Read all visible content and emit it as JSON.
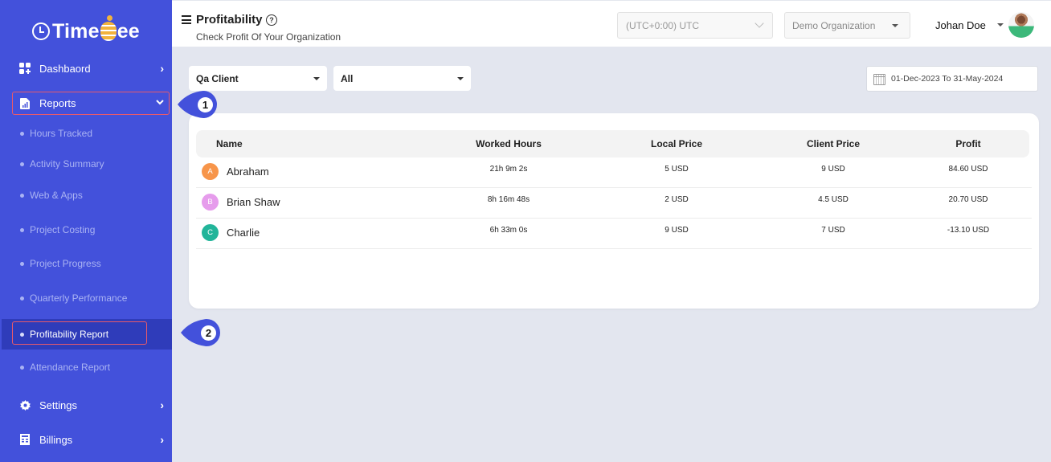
{
  "brand": {
    "name_part1": "Time",
    "name_part2": "ee"
  },
  "sidebar": {
    "items": [
      {
        "label": "Dashbaord",
        "icon": "dashboard-icon",
        "chevron": "›"
      },
      {
        "label": "Reports",
        "icon": "report-icon",
        "chevron": "⌄"
      },
      {
        "label": "Settings",
        "icon": "gear-icon",
        "chevron": "›"
      },
      {
        "label": "Billings",
        "icon": "billing-icon",
        "chevron": "›"
      }
    ],
    "report_subitems": [
      {
        "label": "Hours Tracked"
      },
      {
        "label": "Activity Summary"
      },
      {
        "label": "Web & Apps"
      },
      {
        "label": "Project Costing"
      },
      {
        "label": "Project Progress"
      },
      {
        "label": "Quarterly Performance"
      },
      {
        "label": "Profitability Report",
        "active": true
      },
      {
        "label": "Attendance Report"
      }
    ]
  },
  "header": {
    "title": "Profitability",
    "help_glyph": "?",
    "subtitle": "Check Profit Of Your Organization",
    "timezone": "(UTC+0:00) UTC",
    "organization": "Demo Organization",
    "user_name": "Johan Doe"
  },
  "filters": {
    "client": "Qa Client",
    "project": "All",
    "date_range": "01-Dec-2023 To 31-May-2024"
  },
  "table": {
    "columns": [
      "Name",
      "Worked Hours",
      "Local Price",
      "Client Price",
      "Profit"
    ],
    "rows": [
      {
        "initial": "A",
        "name": "Abraham",
        "color": "#f7954a",
        "worked": "21h 9m 2s",
        "local": "5 USD",
        "client": "9 USD",
        "profit": "84.60 USD"
      },
      {
        "initial": "B",
        "name": "Brian Shaw",
        "color": "#e69cec",
        "worked": "8h 16m 48s",
        "local": "2 USD",
        "client": "4.5 USD",
        "profit": "20.70 USD"
      },
      {
        "initial": "C",
        "name": "Charlie",
        "color": "#22b59a",
        "worked": "6h 33m 0s",
        "local": "9 USD",
        "client": "7 USD",
        "profit": "-13.10 USD"
      }
    ]
  },
  "callouts": [
    {
      "number": "1"
    },
    {
      "number": "2"
    }
  ],
  "colors": {
    "sidebar_bg": "#4351db",
    "sidebar_active_bg": "#2f3cba",
    "highlight_outline": "#e85a6a",
    "page_bg": "#e3e6ef"
  }
}
